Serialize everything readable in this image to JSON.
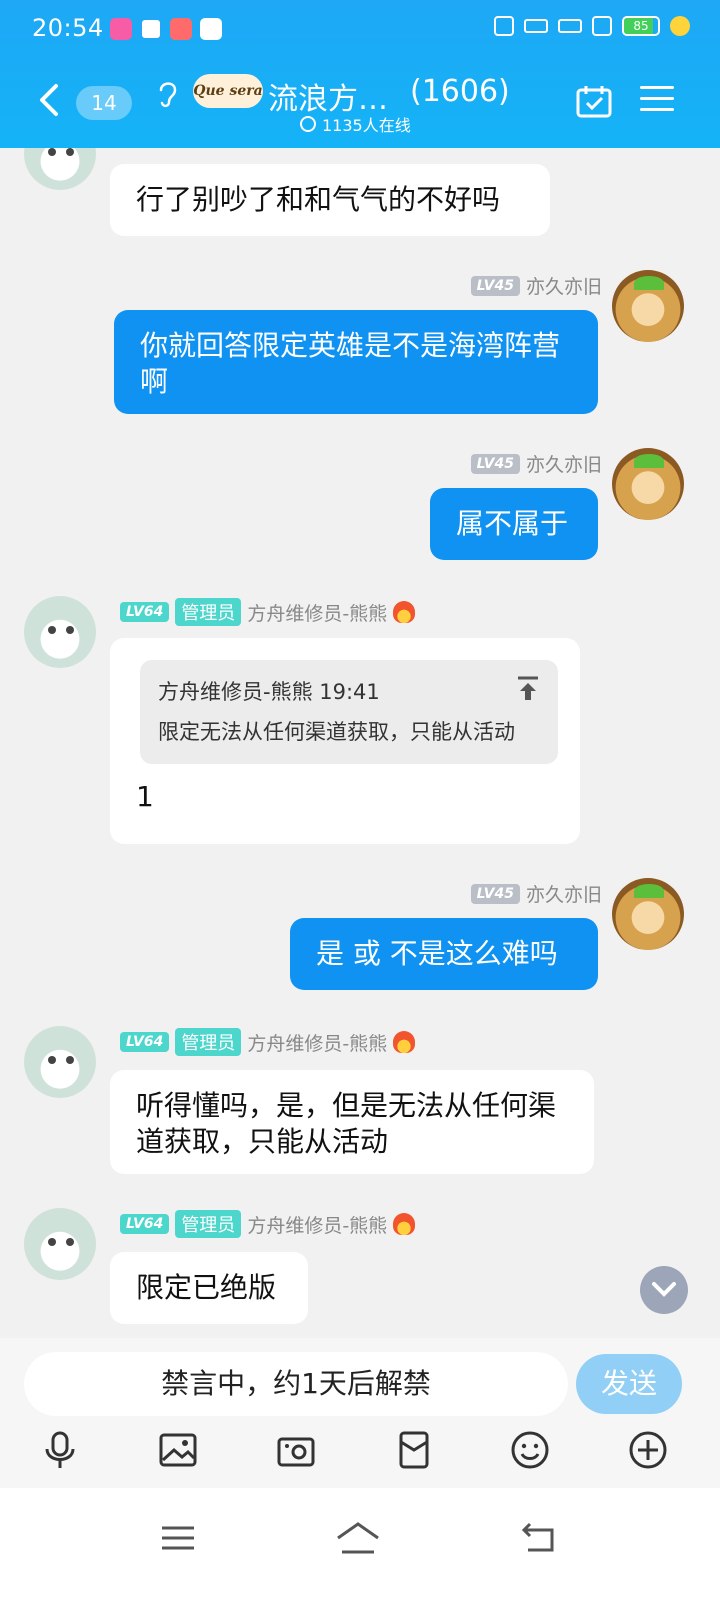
{
  "status_bar": {
    "time": "20:54",
    "battery": "85",
    "battery_level_percent": 85
  },
  "header": {
    "unread_count": "14",
    "logo_text": "Que sera",
    "group_name": "流浪方…",
    "member_count": "(1606)",
    "online_text": "1135人在线"
  },
  "messages": [
    {
      "text": "行了别吵了和和气气的不好吗"
    },
    {
      "level": "LV45",
      "sender": "亦久亦旧",
      "text": "你就回答限定英雄是不是海湾阵营 啊"
    },
    {
      "level": "LV45",
      "sender": "亦久亦旧",
      "text": "属不属于"
    },
    {
      "level": "LV64",
      "role": "管理员",
      "sender": "方舟维修员-熊熊",
      "quote_header": "方舟维修员-熊熊 19:41",
      "quote_text": "限定无法从任何渠道获取，只能从活动",
      "text": "1"
    },
    {
      "level": "LV45",
      "sender": "亦久亦旧",
      "text": "是 或 不是这么难吗"
    },
    {
      "level": "LV64",
      "role": "管理员",
      "sender": "方舟维修员-熊熊",
      "text": "听得懂吗，是，但是无法从任何渠道获取，只能从活动"
    },
    {
      "level": "LV64",
      "role": "管理员",
      "sender": "方舟维修员-熊熊",
      "text": "限定已绝版"
    }
  ],
  "input": {
    "placeholder": "禁言中，约1天后解禁",
    "send_label": "发送"
  },
  "colors": {
    "header_blue": "#1ea8f5",
    "my_bubble": "#0f92f2",
    "level_badge": "#4dd6cb",
    "send_button": "#91cff6"
  },
  "icons": [
    "back-icon",
    "calendar-check-icon",
    "menu-icon",
    "microphone-icon",
    "image-icon",
    "camera-icon",
    "red-packet-icon",
    "emoji-icon",
    "plus-icon"
  ]
}
